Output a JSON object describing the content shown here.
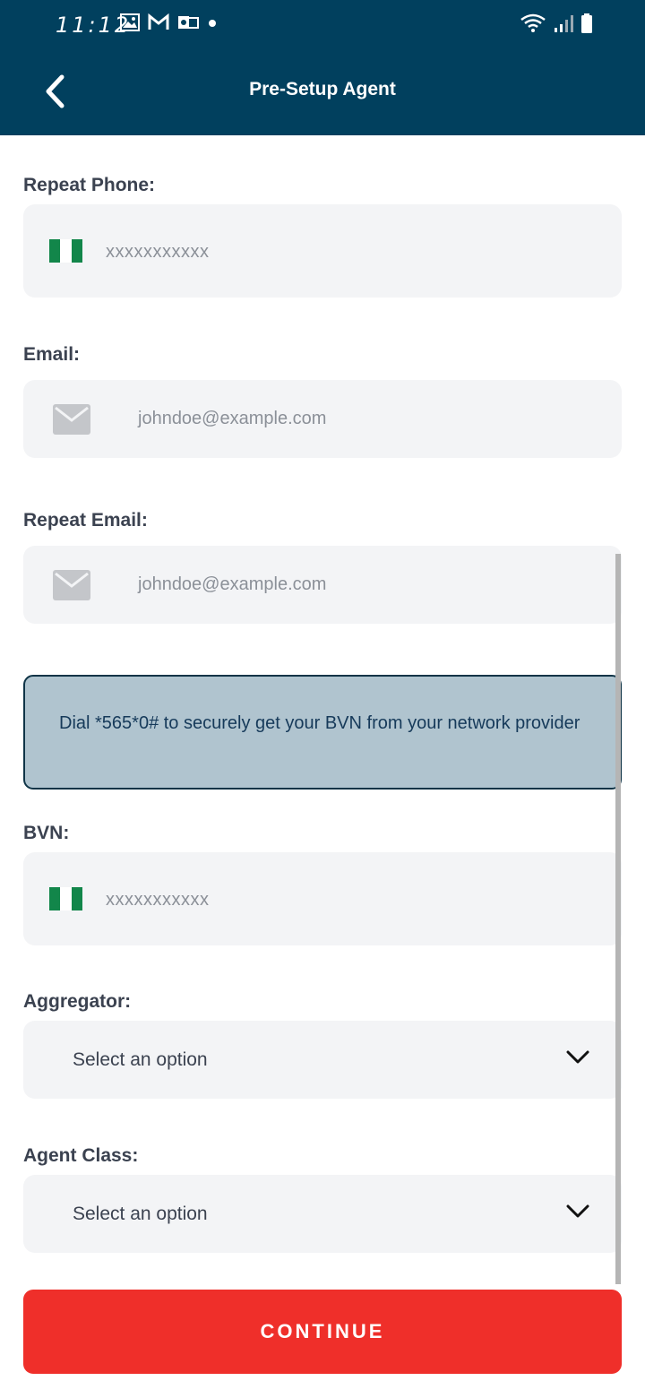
{
  "status_bar": {
    "time": "11:12",
    "icons_left": [
      "image-icon",
      "gmail-icon",
      "outlook-icon",
      "dot-icon"
    ],
    "icons_right": [
      "wifi-icon",
      "signal-icon",
      "battery-icon"
    ]
  },
  "header": {
    "title": "Pre-Setup Agent",
    "background": "#01405e"
  },
  "form": {
    "repeat_phone": {
      "label": "Repeat Phone:",
      "placeholder": "xxxxxxxxxxx"
    },
    "email": {
      "label": "Email:",
      "placeholder": "johndoe@example.com"
    },
    "repeat_email": {
      "label": "Repeat Email:",
      "placeholder": "johndoe@example.com"
    },
    "info": {
      "text": "Dial *565*0# to securely get your BVN from your network provider"
    },
    "bvn": {
      "label": "BVN:",
      "placeholder": "xxxxxxxxxxx"
    },
    "aggregator": {
      "label": "Aggregator:",
      "value": "Select an option"
    },
    "agent_class": {
      "label": "Agent Class:",
      "value": "Select an option"
    }
  },
  "actions": {
    "continue_label": "CONTINUE",
    "continue_color": "#ef2f2a"
  }
}
